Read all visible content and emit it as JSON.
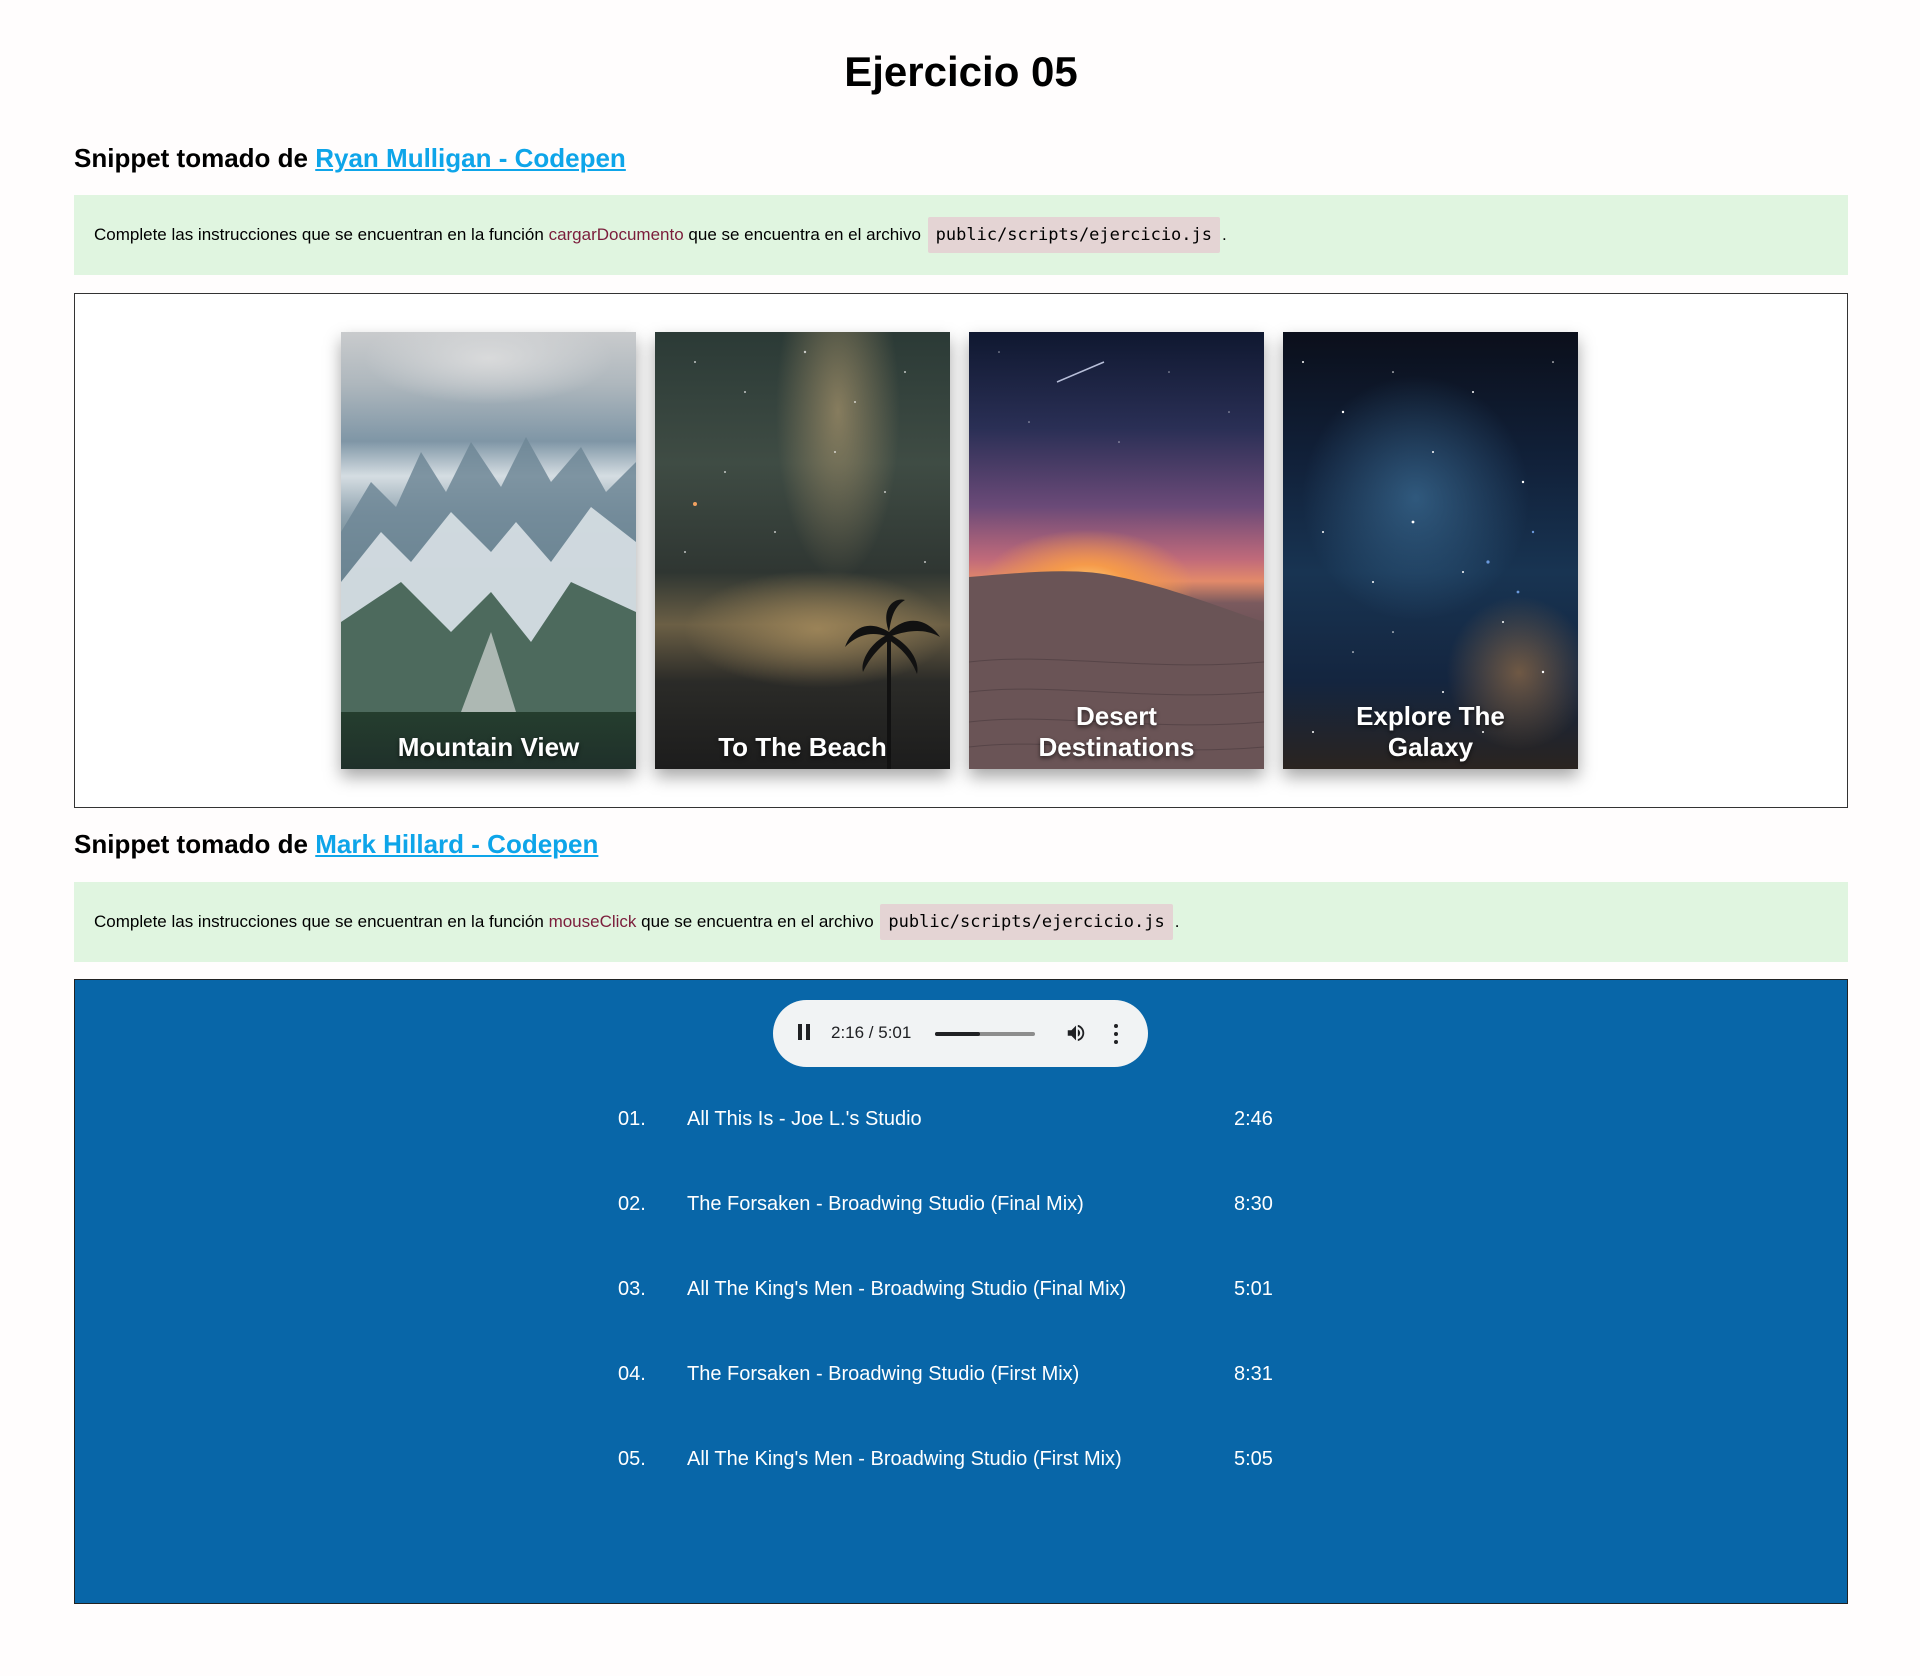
{
  "page": {
    "title": "Ejercicio 05"
  },
  "section1": {
    "heading_prefix": "Snippet tomado de",
    "link_text": "Ryan Mulligan - Codepen",
    "note": {
      "text_before": "Complete las instrucciones que se encuentran en la función",
      "function_name": "cargarDocumento",
      "text_middle": "que se encuentra en el archivo",
      "file_path": "public/scripts/ejercicio.js",
      "text_after": "."
    },
    "cards": [
      {
        "label_line1": "Mountain View",
        "label_line2": ""
      },
      {
        "label_line1": "To The Beach",
        "label_line2": ""
      },
      {
        "label_line1": "Desert",
        "label_line2": "Destinations"
      },
      {
        "label_line1": "Explore The",
        "label_line2": "Galaxy"
      }
    ]
  },
  "section2": {
    "heading_prefix": "Snippet tomado de",
    "link_text": "Mark Hillard - Codepen",
    "note": {
      "text_before": "Complete las instrucciones que se encuentran en la función",
      "function_name": "mouseClick",
      "text_middle": "que se encuentra en el archivo",
      "file_path": "public/scripts/ejercicio.js",
      "text_after": "."
    },
    "player": {
      "time_display": "2:16 / 5:01",
      "progress": 0.45,
      "icons": [
        "pause-icon",
        "volume-icon",
        "more-options-icon"
      ]
    },
    "tracks": [
      {
        "num": "01.",
        "name": "All This Is - Joe L.'s Studio",
        "duration": "2:46"
      },
      {
        "num": "02.",
        "name": "The Forsaken - Broadwing Studio (Final Mix)",
        "duration": "8:30"
      },
      {
        "num": "03.",
        "name": "All The King's Men - Broadwing Studio (Final Mix)",
        "duration": "5:01"
      },
      {
        "num": "04.",
        "name": "The Forsaken - Broadwing Studio (First Mix)",
        "duration": "8:31"
      },
      {
        "num": "05.",
        "name": "All The King's Men - Broadwing Studio (First Mix)",
        "duration": "5:05"
      }
    ]
  },
  "colors": {
    "link": "#0ea5e9",
    "note_background": "#e0f5e0",
    "function_name": "#7b1d3b",
    "player_background": "#0866a8"
  }
}
